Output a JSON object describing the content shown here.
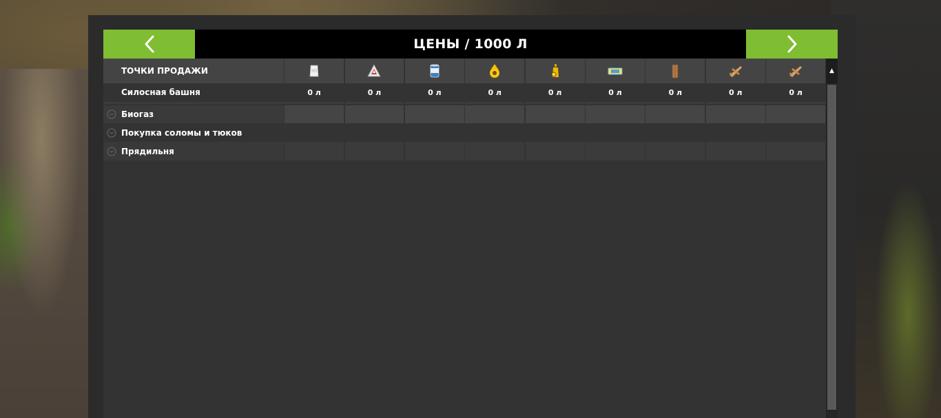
{
  "header": {
    "title": "ЦЕНЫ / 1000 Л"
  },
  "table": {
    "header_label": "ТОЧКИ ПРОДАЖИ",
    "columns": [
      {
        "icon": "flour-bag-icon"
      },
      {
        "icon": "sugar-cube-icon"
      },
      {
        "icon": "canned-food-icon"
      },
      {
        "icon": "sunflower-oil-drop-icon"
      },
      {
        "icon": "oil-bottle-icon"
      },
      {
        "icon": "butter-pack-icon"
      },
      {
        "icon": "wooden-plank-icon"
      },
      {
        "icon": "wooden-toy-plane-icon"
      },
      {
        "icon": "wooden-toy-plane-icon"
      }
    ],
    "rows": [
      {
        "name": "Силосная башня",
        "values": [
          "0 л",
          "0 л",
          "0 л",
          "0 л",
          "0 л",
          "0 л",
          "0 л",
          "0 л",
          "0 л"
        ]
      },
      {
        "name": "Биогаз"
      },
      {
        "name": "Покупка соломы и тюков"
      },
      {
        "name": "Прядильня"
      }
    ]
  },
  "scrollbar": {
    "up_arrow": "▲"
  },
  "colors": {
    "accent": "#7fbd33",
    "header_bg": "#000000",
    "panel_bg": "#333333"
  }
}
